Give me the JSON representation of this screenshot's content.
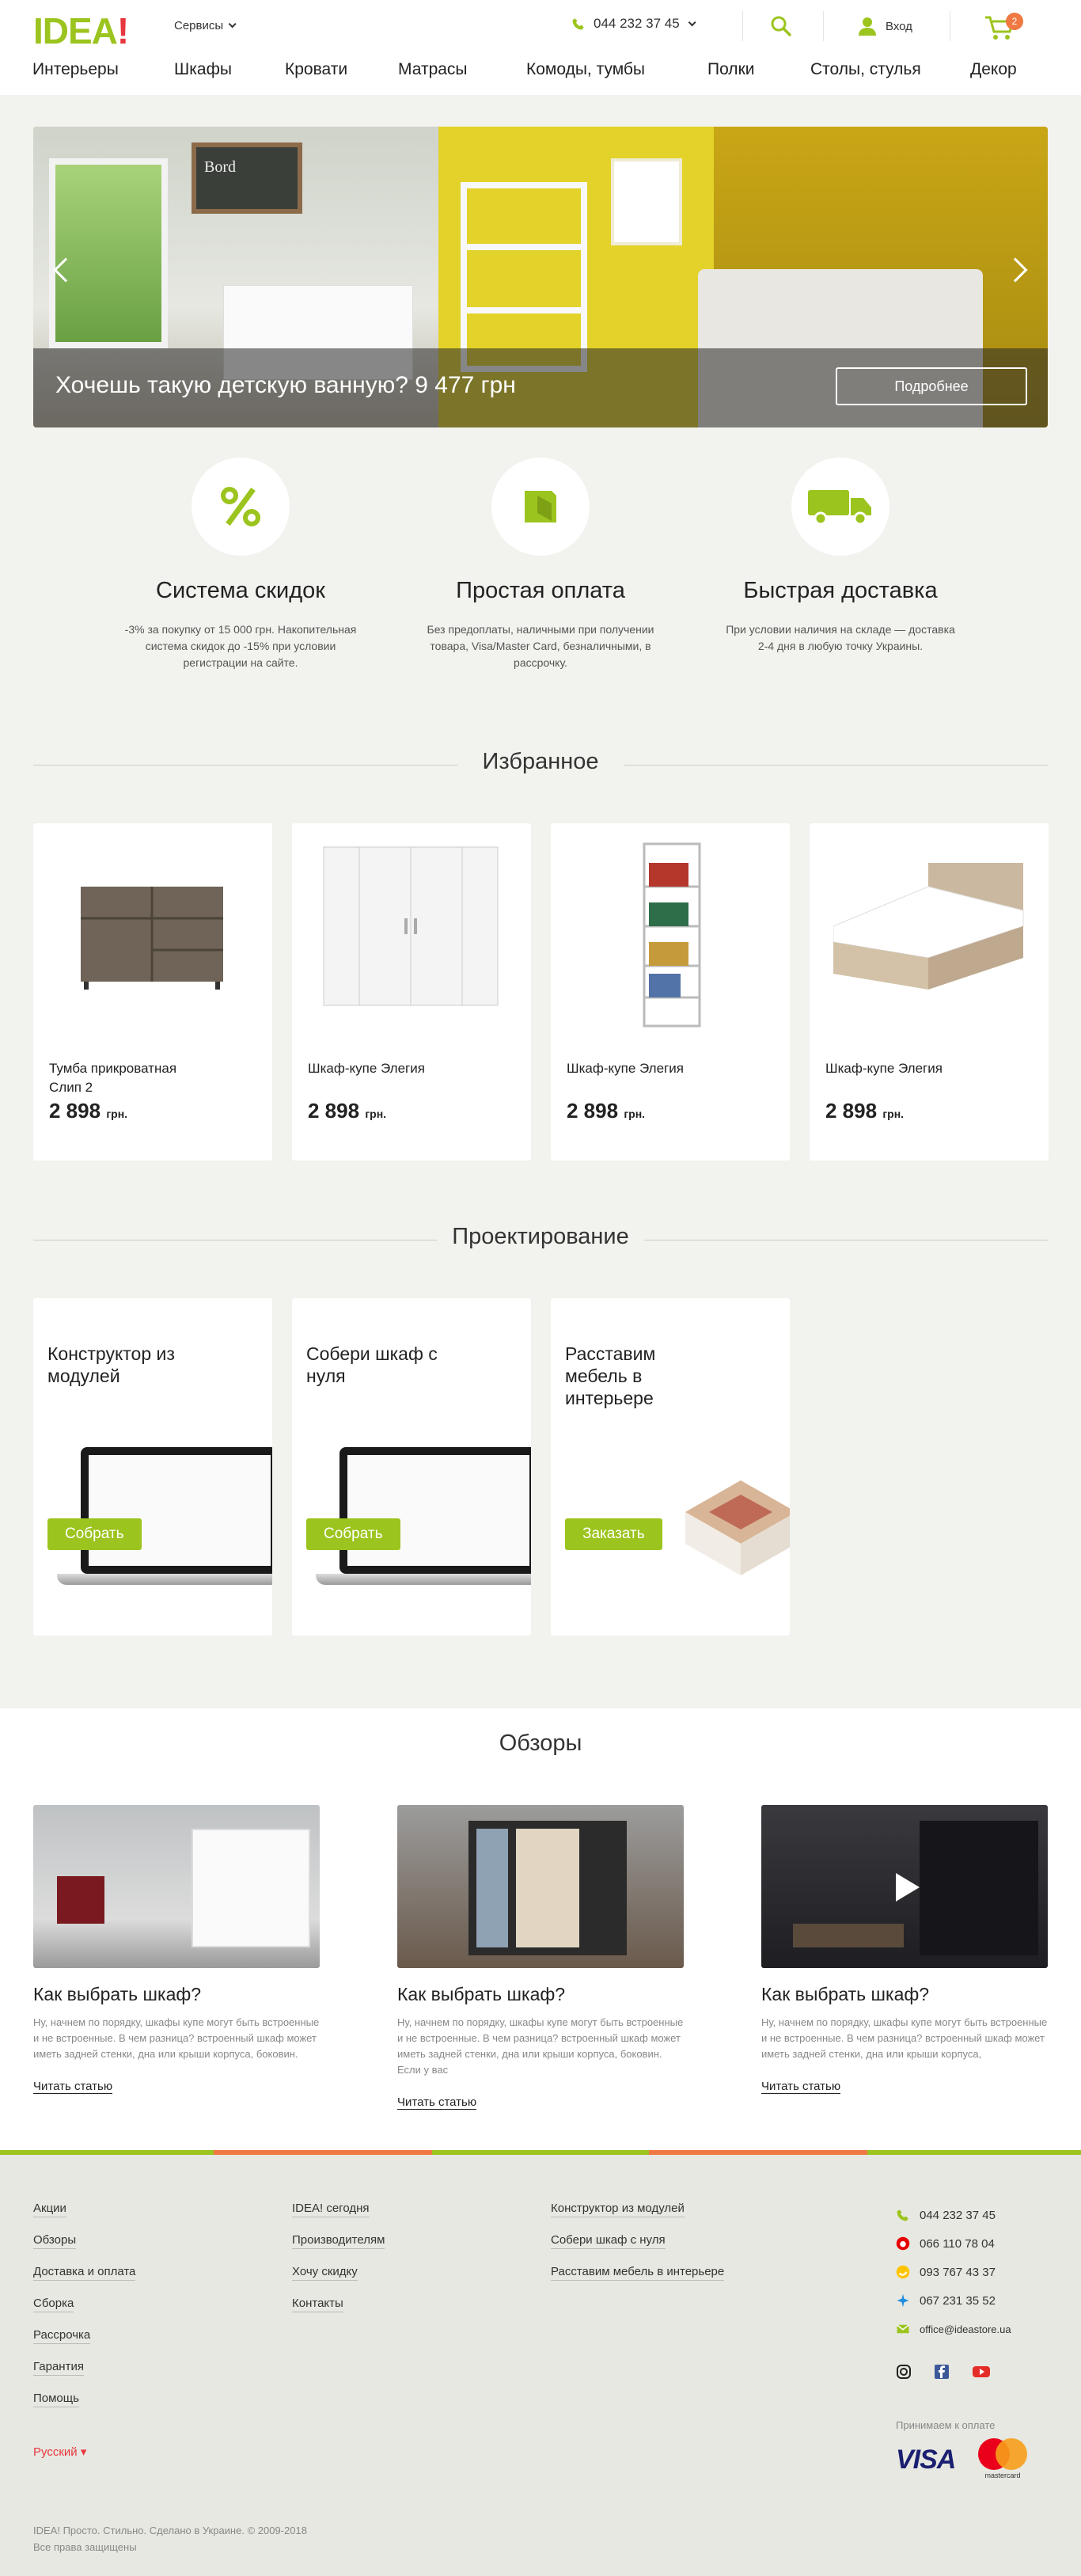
{
  "header": {
    "logo_main": "IDEA",
    "logo_bang": "!",
    "services_label": "Сервисы",
    "phone": "044 232 37 45",
    "login_label": "Вход",
    "cart_count": "2"
  },
  "nav": [
    "Интерьеры",
    "Шкафы",
    "Кровати",
    "Матрасы",
    "Комоды, тумбы",
    "Полки",
    "Столы, стулья",
    "Декор"
  ],
  "hero": {
    "caption": "Хочешь такую детскую ванную? 9 477 грн",
    "button_label": "Подробнее",
    "board_text": "Bord"
  },
  "features": [
    {
      "icon": "percent-icon",
      "title": "Система скидок",
      "text": "-3% за покупку от 15 000 грн. Накопительная система скидок до -15% при условии регистрации на сайте."
    },
    {
      "icon": "wallet-icon",
      "title": "Простая оплата",
      "text": "Без предоплаты, наличными при получении товара, Visa/Master Card, безналичными, в рассрочку."
    },
    {
      "icon": "truck-icon",
      "title": "Быстрая доставка",
      "text": "При условии наличия на складе — доставка 2-4 дня в любую точку Украины."
    }
  ],
  "favorites": {
    "title": "Избранное",
    "items": [
      {
        "name": "Тумба прикроватная Слип 2",
        "price": "2 898",
        "currency": "грн."
      },
      {
        "name": "Шкаф-купе Элегия",
        "price": "2 898",
        "currency": "грн."
      },
      {
        "name": "Шкаф-купе Элегия",
        "price": "2 898",
        "currency": "грн."
      },
      {
        "name": "Шкаф-купе Элегия",
        "price": "2 898",
        "currency": "грн."
      }
    ]
  },
  "design": {
    "title": "Проектирование",
    "items": [
      {
        "title": "Конструктор из модулей",
        "button": "Собрать"
      },
      {
        "title": "Собери шкаф с нуля",
        "button": "Собрать"
      },
      {
        "title": "Расставим мебель в интерьере",
        "button": "Заказать"
      }
    ]
  },
  "reviews": {
    "title": "Обзоры",
    "items": [
      {
        "title": "Как выбрать шкаф?",
        "text": "Ну, начнем по порядку, шкафы купе могут быть встроенные и не встроенные. В чем разница? встроенный шкаф может  иметь задней стенки, дна или крыши корпуса, боковин.",
        "link": "Читать статью"
      },
      {
        "title": "Как выбрать шкаф?",
        "text": "Ну, начнем по порядку, шкафы купе могут быть встроенные и не встроенные. В чем разница? встроенный шкаф может  иметь задней стенки, дна или крыши корпуса, боковин. Если у вас",
        "link": "Читать статью"
      },
      {
        "title": "Как выбрать шкаф?",
        "text": "Ну, начнем по порядку, шкафы купе могут быть встроенные и не встроенные. В чем разница? встроенный шкаф может  иметь задней стенки, дна или крыши корпуса,",
        "link": "Читать статью"
      }
    ]
  },
  "footer": {
    "col1": [
      "Акции",
      "Обзоры",
      "Доставка и оплата",
      "Сборка",
      "Рассрочка",
      "Гарантия",
      "Помощь"
    ],
    "col2": [
      "IDEA! сегодня",
      "Производителям",
      "Хочу скидку",
      "Контакты"
    ],
    "col3": [
      "Конструктор из модулей",
      "Собери шкаф с нуля",
      "Расставим мебель в интерьере"
    ],
    "contacts": [
      "044 232 37 45",
      "066 110 78 04",
      "093 767 43 37",
      "067 231 35 52",
      "office@ideastore.ua"
    ],
    "pay_label": "Принимаем к оплате",
    "visa": "VISA",
    "mastercard": "mastercard",
    "language": "Русский",
    "copyright_1": "IDEA! Просто. Стильно. Сделано в Украине. © 2009-2018",
    "copyright_2": "Все права защищены"
  },
  "colors": {
    "accent": "#9cc41e",
    "brand_red": "#e8363f",
    "badge": "#f07843"
  }
}
